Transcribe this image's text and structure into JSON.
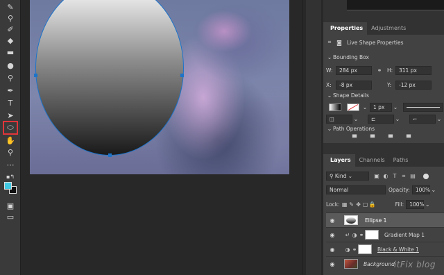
{
  "toolbar": {
    "tools": [
      "brush-tool-icon",
      "clone-stamp-icon",
      "history-brush-icon",
      "eraser-icon",
      "gradient-icon",
      "blur-icon",
      "dodge-icon",
      "pen-icon",
      "type-icon",
      "path-select-icon",
      "ellipse-tool-icon",
      "hand-icon",
      "zoom-icon",
      "more-icon"
    ],
    "selected_tool": "ellipse-tool-icon",
    "foreground_color": "#41c9e3",
    "background_color": "#111111"
  },
  "properties_panel": {
    "tabs": [
      {
        "label": "Properties"
      },
      {
        "label": "Adjustments"
      }
    ],
    "header": "Live Shape Properties",
    "bounding_box": {
      "title": "Bounding Box",
      "w_label": "W:",
      "w_value": "284 px",
      "h_label": "H:",
      "h_value": "311 px",
      "x_label": "X:",
      "x_value": "-8 px",
      "y_label": "Y:",
      "y_value": "-12 px"
    },
    "shape_details": {
      "title": "Shape Details",
      "stroke_width": "1 px"
    },
    "path_operations": {
      "title": "Path Operations"
    }
  },
  "layers_panel": {
    "tabs": [
      {
        "label": "Layers"
      },
      {
        "label": "Channels"
      },
      {
        "label": "Paths"
      }
    ],
    "filter": "Kind",
    "blend_mode": "Normal",
    "opacity_label": "Opacity:",
    "opacity_value": "100%",
    "lock_label": "Lock:",
    "fill_label": "Fill:",
    "fill_value": "100%",
    "layers": [
      {
        "name": "Ellipse 1",
        "selected": true
      },
      {
        "name": "Gradient Map 1",
        "selected": false
      },
      {
        "name": "Black & White 1",
        "selected": false
      },
      {
        "name": "Background",
        "selected": false
      }
    ]
  },
  "watermark": "itFix blog"
}
